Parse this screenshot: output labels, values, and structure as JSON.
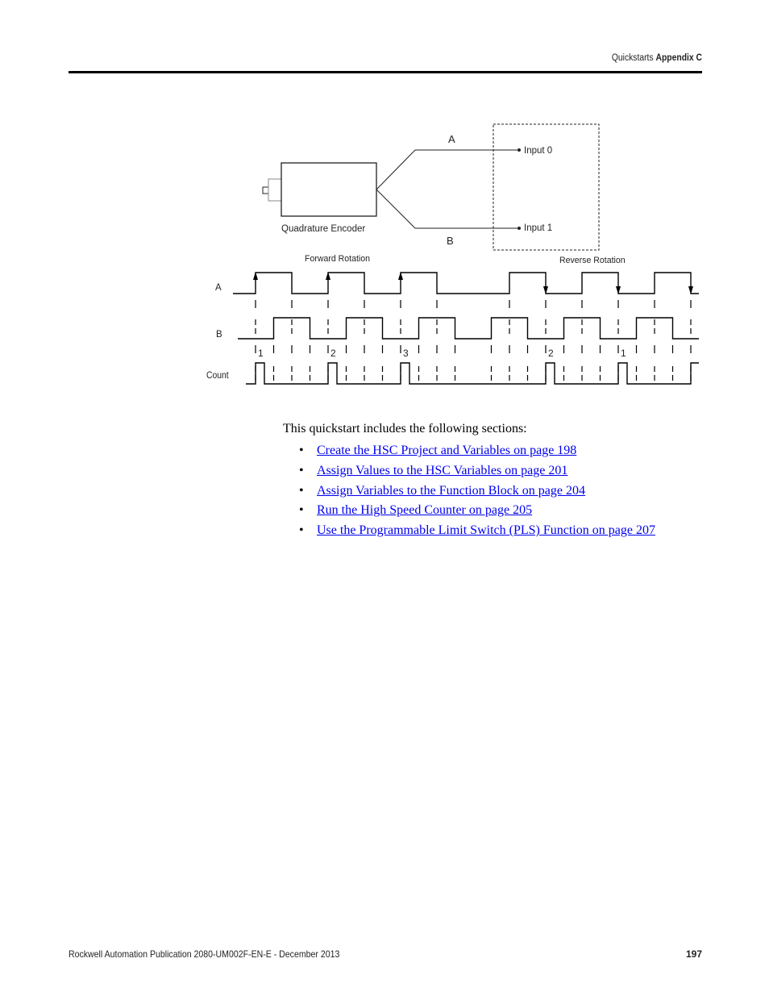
{
  "header": {
    "section": "Quickstarts",
    "appendix": "Appendix C"
  },
  "diagram": {
    "encoder_label": "Quadrature Encoder",
    "wire_a_label": "A",
    "wire_b_label": "B",
    "input0_label": "Input 0",
    "input1_label": "Input 1",
    "forward_label": "Forward Rotation",
    "reverse_label": "Reverse Rotation",
    "row_labels": {
      "a": "A",
      "b": "B",
      "count": "Count"
    },
    "timing": {
      "unit_note": "edge times in quarter-cycle units (t=0 at first A rising edge)",
      "a_edges": [
        0,
        2,
        4,
        6,
        8,
        10,
        14,
        16,
        18,
        20,
        22,
        24
      ],
      "a_start_level": 0,
      "b_edges": [
        1,
        3,
        5,
        7,
        9,
        11,
        13,
        15,
        17,
        19,
        21,
        23
      ],
      "b_start_level": 0,
      "forward_arrows_at": [
        0,
        4,
        8
      ],
      "reverse_arrows_at": [
        16,
        20,
        24
      ],
      "count_pulses": [
        {
          "at": 0,
          "label": "1"
        },
        {
          "at": 4,
          "label": "2"
        },
        {
          "at": 8,
          "label": "3"
        },
        {
          "at": 16,
          "label": "2"
        },
        {
          "at": 20,
          "label": "1"
        },
        {
          "at": 24,
          "label": ""
        }
      ]
    }
  },
  "body": {
    "intro": "This quickstart includes the following sections:",
    "links": [
      "Create the HSC Project and Variables on page 198",
      "Assign Values to the HSC Variables on page 201",
      "Assign Variables to the Function Block on page 204",
      "Run the High Speed Counter on page 205",
      "Use the Programmable Limit Switch (PLS) Function on page 207"
    ]
  },
  "footer": {
    "publication": "Rockwell Automation Publication 2080-UM002F-EN-E - December 2013",
    "page_number": "197"
  }
}
